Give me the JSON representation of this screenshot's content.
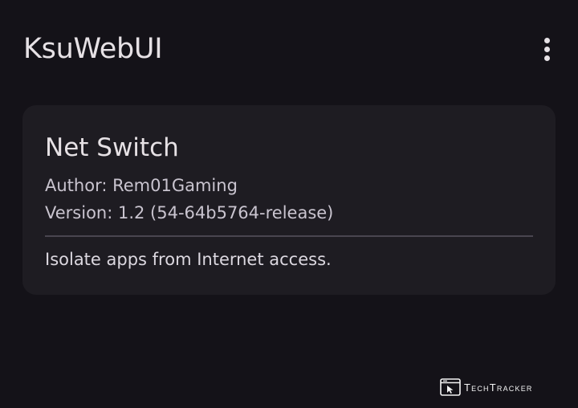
{
  "header": {
    "title": "KsuWebUI",
    "overflow_icon": "more-vert-icon"
  },
  "module": {
    "name": "Net Switch",
    "author": "Author: Rem01Gaming",
    "version": "Version: 1.2 (54-64b5764-release)",
    "description": "Isolate apps from Internet access."
  },
  "watermark": {
    "text": "TechTracker",
    "icon": "browser-cursor-icon"
  },
  "colors": {
    "background": "#141218",
    "card": "#1e1c22",
    "text_primary": "#e6e1e5",
    "text_secondary": "#c9c4cf",
    "divider": "#49454f"
  }
}
